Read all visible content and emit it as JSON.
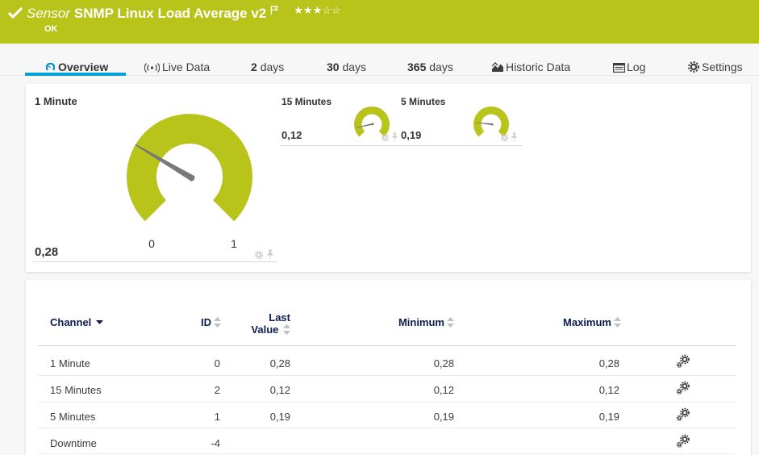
{
  "header": {
    "kind": "Sensor",
    "title": "SNMP Linux Load Average v2",
    "status": "OK",
    "rating_filled": "★★★",
    "rating_empty": "☆☆"
  },
  "tabs": [
    {
      "label": "Overview",
      "active": true
    },
    {
      "label": "Live Data"
    },
    {
      "num": "2",
      "label": "days"
    },
    {
      "num": "30",
      "label": "days"
    },
    {
      "num": "365",
      "label": "days"
    },
    {
      "label": "Historic Data"
    },
    {
      "label": "Log"
    },
    {
      "label": "Settings"
    }
  ],
  "chart_data": [
    {
      "type": "gauge",
      "title": "1 Minute",
      "value": 0.28,
      "value_display": "0,28",
      "min": 0,
      "max": 1,
      "sweep_deg": 270,
      "tick_min": "0",
      "tick_max": "1",
      "color": "#b8c419"
    },
    {
      "type": "gauge",
      "title": "15 Minutes",
      "value": 0.12,
      "value_display": "0,12",
      "min": 0,
      "max": 1,
      "sweep_deg": 270,
      "color": "#b8c419"
    },
    {
      "type": "gauge",
      "title": "5 Minutes",
      "value": 0.19,
      "value_display": "0,19",
      "min": 0,
      "max": 1,
      "sweep_deg": 270,
      "color": "#b8c419"
    }
  ],
  "table": {
    "headers": {
      "channel": "Channel",
      "id": "ID",
      "last_line1": "Last",
      "last_line2": "Value",
      "min": "Minimum",
      "max": "Maximum"
    },
    "rows": [
      {
        "channel": "1 Minute",
        "id": "0",
        "last": "0,28",
        "min": "0,28",
        "max": "0,28"
      },
      {
        "channel": "15 Minutes",
        "id": "2",
        "last": "0,12",
        "min": "0,12",
        "max": "0,12"
      },
      {
        "channel": "5 Minutes",
        "id": "1",
        "last": "0,19",
        "min": "0,19",
        "max": "0,19"
      },
      {
        "channel": "Downtime",
        "id": "-4",
        "last": "",
        "min": "",
        "max": ""
      }
    ]
  },
  "colors": {
    "brand_green": "#b8c419",
    "accent_blue": "#00a3da",
    "header_navy": "#0d1c4f"
  }
}
